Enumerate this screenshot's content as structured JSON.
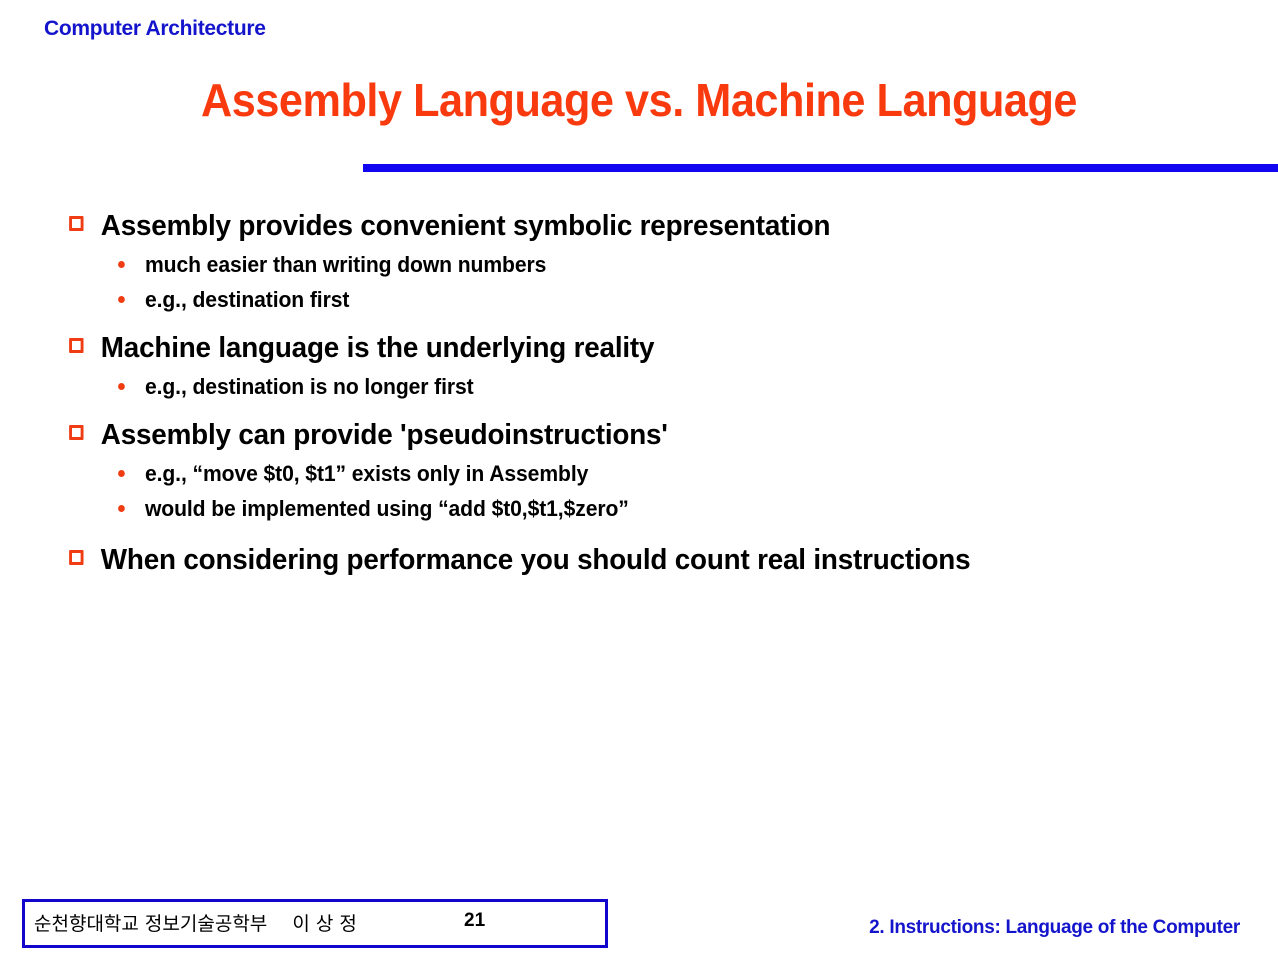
{
  "header": {
    "course": "Computer Architecture"
  },
  "title": {
    "text": "Assembly Language vs. Machine Language",
    "color": "#f93a0e"
  },
  "rule": {
    "color": "#1205f0"
  },
  "body": {
    "bullets": [
      {
        "level": 1,
        "text": "Assembly provides convenient symbolic representation"
      },
      {
        "level": 2,
        "text": "much easier than writing down numbers"
      },
      {
        "level": 2,
        "text": "e.g., destination first"
      },
      {
        "level": 1,
        "text": "Machine language is the underlying reality"
      },
      {
        "level": 2,
        "text": "e.g., destination is no longer first"
      },
      {
        "level": 1,
        "text": "Assembly can provide 'pseudoinstructions'"
      },
      {
        "level": 2,
        "text": "e.g., “move $t0, $t1” exists only in Assembly"
      },
      {
        "level": 2,
        "text": "would be implemented using “add $t0,$t1,$zero”"
      },
      {
        "level": 1,
        "text": "When considering performance you should count real instructions"
      }
    ],
    "marker_level1": "hollow-square-bullet",
    "marker_level2": "round-dot-bullet",
    "marker_color": "#f03c12"
  },
  "footer": {
    "affiliation": "순천향대학교 정보기술공학부  이 상 정",
    "page_number": "21",
    "chapter": "2. Instructions: Language of the Computer",
    "chapter_color": "#1414cc",
    "box_border_color": "#1205cc"
  }
}
